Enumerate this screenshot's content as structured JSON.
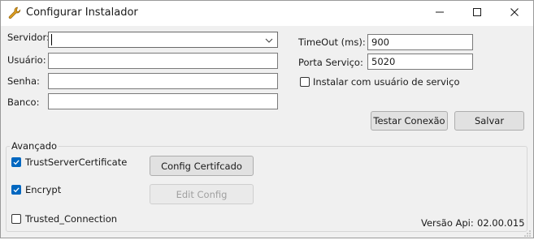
{
  "window": {
    "title": "Configurar Instalador",
    "icon": "wrench-icon",
    "controls": [
      "minimize-icon",
      "maximize-icon",
      "close-icon"
    ]
  },
  "form": {
    "servidor": {
      "label": "Servidor:",
      "value": ""
    },
    "usuario": {
      "label": "Usuário:",
      "value": ""
    },
    "senha": {
      "label": "Senha:",
      "value": ""
    },
    "banco": {
      "label": "Banco:",
      "value": ""
    },
    "timeout": {
      "label": "TimeOut (ms):",
      "value": "900"
    },
    "porta": {
      "label": "Porta Serviço:",
      "value": "5020"
    },
    "instalar_servico": {
      "label": "Instalar com usuário de serviço",
      "checked": false
    }
  },
  "buttons": {
    "testar": "Testar Conexão",
    "salvar": "Salvar",
    "config_cert": "Config Certifcado",
    "edit_config": "Edit Config"
  },
  "avancado": {
    "title": "Avançado",
    "trust_cert": {
      "label": "TrustServerCertificate",
      "checked": true
    },
    "encrypt": {
      "label": "Encrypt",
      "checked": true
    },
    "trusted_conn": {
      "label": "Trusted_Connection",
      "checked": false
    }
  },
  "versao": {
    "label": "Versão Api:",
    "value": "02.00.015"
  },
  "colors": {
    "accent": "#0067c0",
    "background": "#f0f0f0",
    "titlebar": "#ffffff"
  }
}
